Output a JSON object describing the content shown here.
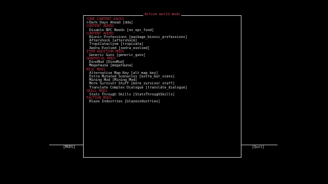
{
  "window": {
    "title": "Active world mods"
  },
  "footer": {
    "left_label": "[MODS]",
    "right_label": "[Quit]"
  },
  "list": {
    "cursor": ">"
  },
  "categories": [
    {
      "label": "CORE CONTENT PACKS",
      "mods": [
        {
          "label": "Dark Days Ahead [dda]",
          "selected": true
        }
      ]
    },
    {
      "label": "CONTENT ADDED",
      "mods": [
        {
          "label": "Disable NPC Needs [no_npc_food]",
          "selected": false
        }
      ]
    },
    {
      "label": "CONTENT ADDED",
      "mods": [
        {
          "label": "Bionic Professions [package_bionic_professions]",
          "selected": false
        },
        {
          "label": "Aftershock [aftershock]",
          "selected": false
        },
        {
          "label": "TropiCataclysm [tropicata]",
          "selected": false
        },
        {
          "label": "Xedra Evolved [xedra_evolved]",
          "selected": false
        }
      ]
    },
    {
      "label": "ITEM ADDITION MODS",
      "mods": [
        {
          "label": "Generic Guns [generic_guns]",
          "selected": false
        }
      ]
    },
    {
      "label": "GRAPHICAL MODS",
      "mods": [
        {
          "label": "DinoMod [DinoMod]",
          "selected": false
        },
        {
          "label": "Megafauna [megafauna]",
          "selected": false
        }
      ]
    },
    {
      "label": "MISC MODS",
      "mods": [
        {
          "label": "Alternative Map Key [alt_map_key]",
          "selected": false
        },
        {
          "label": "Extra Mutated Scenarios [extra_mut_scens]",
          "selected": false
        },
        {
          "label": "Mining Mod [Mining_Mod]",
          "selected": false
        },
        {
          "label": "More Survivor Stuff [more_survivor_stuff]",
          "selected": false
        },
        {
          "label": "Translate Complex Dialogue [translate_dialogue]",
          "selected": false
        }
      ]
    },
    {
      "label": "SKILL MODS",
      "mods": [
        {
          "label": "Stats Through Skills [StatsThroughSkills]",
          "selected": false
        }
      ]
    },
    {
      "label": "FACTION MODS",
      "mods": [
        {
          "label": "Blaze Industries [blazeindustries]",
          "selected": false
        }
      ]
    }
  ],
  "colors": {
    "background": "#000000",
    "border": "#a8a8a8",
    "category": "#c23a4a",
    "title": "#d84a5a",
    "text": "#d6d6d6"
  }
}
